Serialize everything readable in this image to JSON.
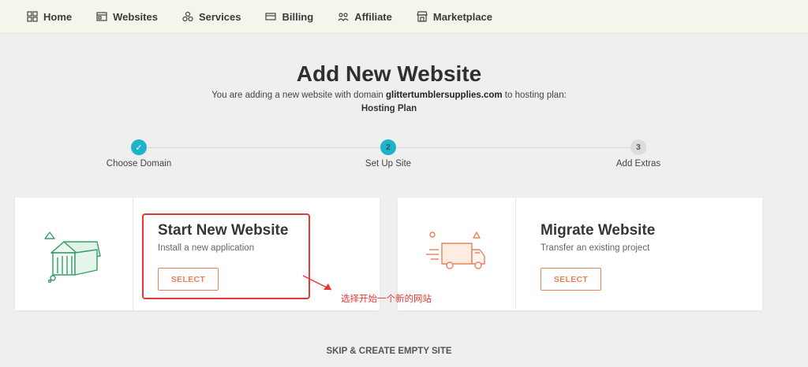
{
  "nav": {
    "items": [
      {
        "label": "Home",
        "icon": "grid-icon"
      },
      {
        "label": "Websites",
        "icon": "browser-icon"
      },
      {
        "label": "Services",
        "icon": "services-icon"
      },
      {
        "label": "Billing",
        "icon": "card-icon"
      },
      {
        "label": "Affiliate",
        "icon": "affiliate-icon"
      },
      {
        "label": "Marketplace",
        "icon": "store-icon"
      }
    ]
  },
  "header": {
    "title": "Add New Website",
    "subtitle_prefix": "You are adding a new website with domain",
    "domain": "glittertumblersupplies.com",
    "subtitle_suffix": "to hosting plan:",
    "plan": "Hosting Plan"
  },
  "steps": [
    {
      "number": "✓",
      "label": "Choose Domain",
      "state": "done"
    },
    {
      "number": "2",
      "label": "Set Up Site",
      "state": "active"
    },
    {
      "number": "3",
      "label": "Add Extras",
      "state": "pending"
    }
  ],
  "cards": {
    "start": {
      "title": "Start New Website",
      "desc": "Install a new application",
      "button": "SELECT"
    },
    "migrate": {
      "title": "Migrate Website",
      "desc": "Transfer an existing project",
      "button": "SELECT"
    }
  },
  "annotation": "选择开始一个新的网站",
  "skip": "SKIP & CREATE EMPTY SITE",
  "colors": {
    "accent": "#1fb2c8",
    "button": "#e8825a",
    "highlight": "#e53935",
    "icon_green": "#3a9a6a"
  }
}
